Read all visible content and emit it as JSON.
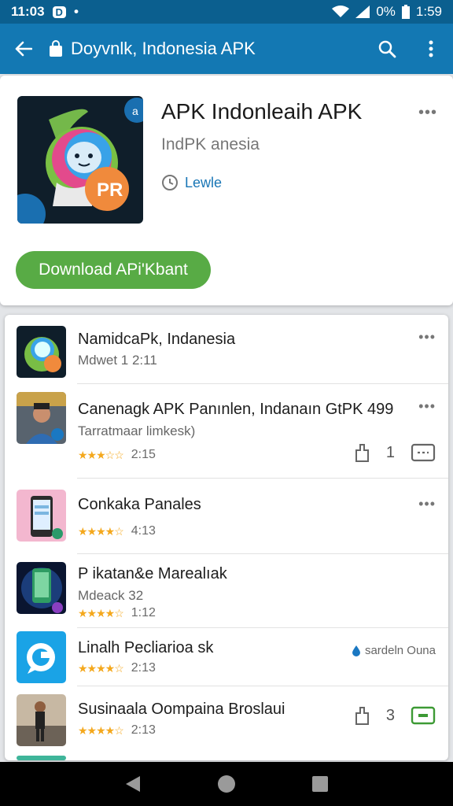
{
  "status_bar": {
    "time_left": "11:03",
    "badge": "D",
    "dots": "•",
    "battery_percent": "0%",
    "time_right": "1:59"
  },
  "app_bar": {
    "title": "Doyvnlk, Indonesia APK"
  },
  "hero": {
    "app_name": "APK Indonleaih APK",
    "developer": "IndPK anesia",
    "updated_label": "Lewle",
    "more": "•••",
    "download_label": "Download APi'Kbant"
  },
  "list": [
    {
      "title": "NamidcaPk, Indanesia",
      "sub": "Mdwet 1 2:11",
      "more": "•••"
    },
    {
      "title": "Canenagk APK Panınlen, Indanaın GtPK 499",
      "sub": "Tarratmaar limkesk)",
      "rating": "2:15",
      "likes": "1",
      "more": "•••"
    },
    {
      "title": "Conkaka Panales",
      "rating": "4:13",
      "more": "•••"
    },
    {
      "title": "P ikatan&e Marealıak",
      "sub": "Mdeack 32",
      "rating": "1:12"
    },
    {
      "title": "Linalh Pecliarioa sk",
      "rating": "2:13",
      "note": "sardeln Ouna"
    },
    {
      "title": "Susinaala Oompaina Broslaui",
      "rating": "2:13",
      "likes": "3"
    }
  ],
  "colors": {
    "status_bar": "#0b5f8f",
    "app_bar": "#1378b3",
    "download_button": "#58ab45",
    "star": "#f4a81d",
    "link": "#1976b6"
  }
}
